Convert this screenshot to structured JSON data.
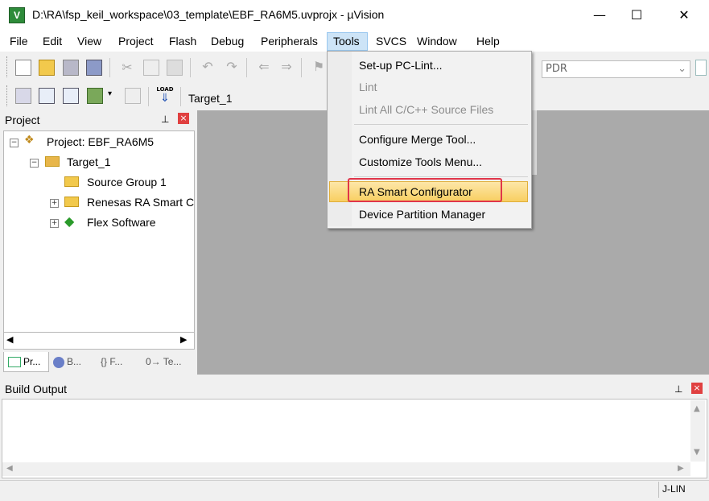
{
  "window": {
    "title": "D:\\RA\\fsp_keil_workspace\\03_template\\EBF_RA6M5.uvprojx - µVision",
    "app_icon_letter": "V",
    "minimize_glyph": "—",
    "maximize_glyph": "☐",
    "close_glyph": "✕"
  },
  "menubar": [
    "File",
    "Edit",
    "View",
    "Project",
    "Flash",
    "Debug",
    "Peripherals",
    "Tools",
    "SVCS",
    "Window",
    "Help"
  ],
  "toolbar": {
    "target_select": "Target_1",
    "pdr_select": "PDR",
    "load_label": "LOAD"
  },
  "project_panel": {
    "title": "Project",
    "pin_glyph": "⊥",
    "close_glyph": "×",
    "tree": [
      {
        "label": "Project: EBF_RA6M5",
        "level": 0,
        "expand": "⊟",
        "icon": "project-icon"
      },
      {
        "label": "Target_1",
        "level": 1,
        "expand": "⊟",
        "icon": "target-folder-icon"
      },
      {
        "label": "Source Group 1",
        "level": 2,
        "expand": "",
        "icon": "folder-icon"
      },
      {
        "label": "Renesas RA Smart C",
        "level": 2,
        "expand": "⊞",
        "icon": "folder-icon"
      },
      {
        "label": "Flex Software",
        "level": 2,
        "expand": "⊞",
        "icon": "flex-icon"
      }
    ],
    "tabs": [
      "Pr...",
      "B...",
      "{} F...",
      "0→ Te..."
    ]
  },
  "tools_menu": {
    "items": [
      {
        "label": "Set-up PC-Lint...",
        "enabled": true
      },
      {
        "label": "Lint",
        "enabled": false
      },
      {
        "label": "Lint All C/C++ Source Files",
        "enabled": false
      },
      {
        "label": "Configure Merge Tool...",
        "enabled": true
      },
      {
        "label": "Customize Tools Menu...",
        "enabled": true
      },
      {
        "label": "RA Smart Configurator",
        "enabled": true,
        "highlighted": true
      },
      {
        "label": "Device Partition Manager",
        "enabled": true
      }
    ]
  },
  "build_output": {
    "title": "Build Output",
    "pin_glyph": "⊥",
    "close_glyph": "×"
  },
  "statusbar": {
    "debugger": "J-LIN"
  },
  "colors": {
    "highlight": "#f8cf61",
    "annotation_box": "#e0354a",
    "workspace": "#aaaaaa"
  }
}
